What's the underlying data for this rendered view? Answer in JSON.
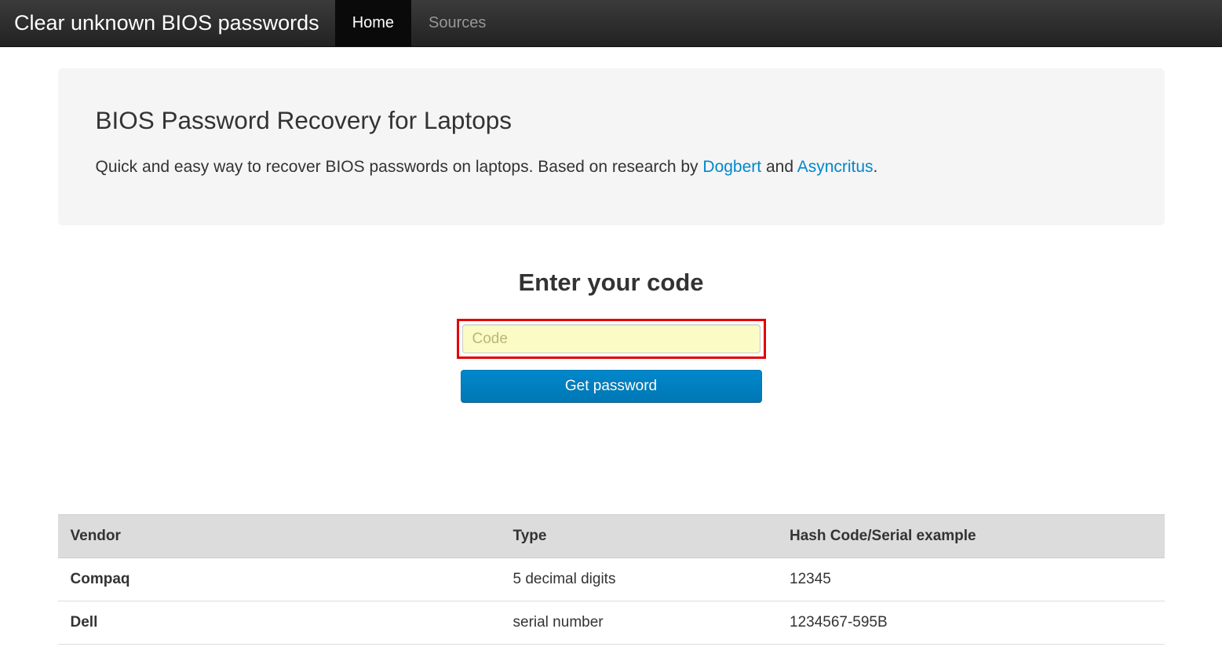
{
  "navbar": {
    "brand": "Clear unknown BIOS passwords",
    "items": [
      {
        "label": "Home",
        "active": true
      },
      {
        "label": "Sources",
        "active": false
      }
    ]
  },
  "hero": {
    "title": "BIOS Password Recovery for Laptops",
    "lead_pre": "Quick and easy way to recover BIOS passwords on laptops. Based on research by ",
    "link1": "Dogbert",
    "lead_mid": " and ",
    "link2": "Asyncritus",
    "lead_post": "."
  },
  "form": {
    "heading": "Enter your code",
    "placeholder": "Code",
    "value": "",
    "submit": "Get password"
  },
  "table": {
    "headers": [
      "Vendor",
      "Type",
      "Hash Code/Serial example"
    ],
    "rows": [
      {
        "vendor": "Compaq",
        "type": "5 decimal digits",
        "example": "12345"
      },
      {
        "vendor": "Dell",
        "type": "serial number",
        "example": "1234567-595B"
      }
    ]
  }
}
